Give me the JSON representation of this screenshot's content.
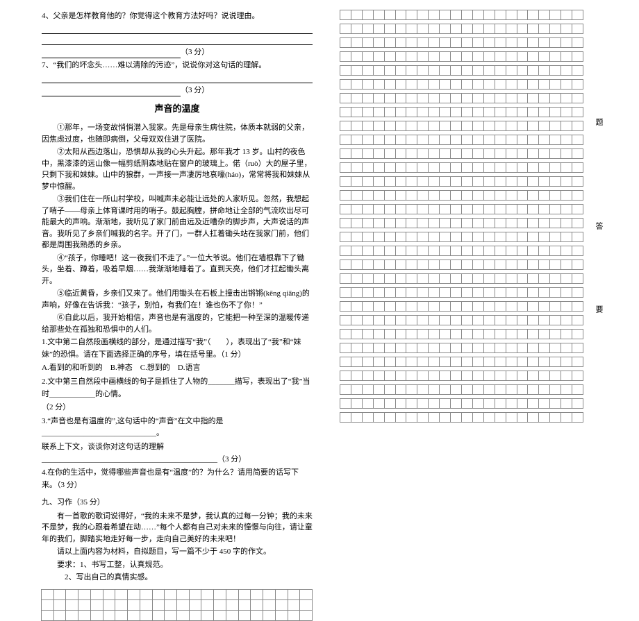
{
  "q4": {
    "prompt": "4、父亲是怎样教育他的？你觉得这个教育方法好吗？说说理由。",
    "score": "（3 分）"
  },
  "q7": {
    "prompt": "7、“我们的坏念头……难以清除的污迹”，说说你对这句话的理解。",
    "score": "（3 分）"
  },
  "reading": {
    "title": "声音的温度",
    "p1": "①那年，一场变故悄悄潜入我家。先是母亲生病住院，体质本就弱的父亲，因焦虑过度，也随即病倒，父母双双住进了医院。",
    "p2": "②太阳从西边落山，恐惧却从我的心头升起。那年我才 13 岁。山村的夜色中，黑漆漆的远山像一幅剪纸阴森地贴在窗户的玻璃上。偌（ruò）大的屋子里，只剩下我和妹妹。山中的狼群，一声接一声凄厉地哀嚎(háo)，常常将我和妹妹从梦中惊醒。",
    "p3": "③我们住在一所山村学校，叫喊声未必能让远处的人家听见。忽然，我想起了哨子——母亲上体育课时用的哨子。鼓起胸膛，拼命地让全部的气流吹出尽可能最大的声响。渐渐地，我听见了家门前由远及近嘈杂的脚步声，大声说话的声音。我听见了乡亲们喊我的名字。开了门，一群人扛着锄头站在我家门前，他们都是周围我熟悉的乡亲。",
    "p4": "④“孩子，你睡吧！这一夜我们不走了。”一位大爷说。他们在墙根靠下了锄头，坐着、蹲着，吸着早烟……我渐渐地睡着了。直到天亮，他们才扛起锄头离开。",
    "p5": "⑤临近黄昏，乡亲们又来了。他们用锄头在石板上撞击出锵锵(kēng qiāng)的声响，好像在告诉我：“孩子，别怕，有我们在！谁也伤不了你！”",
    "p6": "⑥自此以后，我开始相信，声音也是有温度的，它能把一种至深的温暖传递给那些处在孤独和恐惧中的人们。"
  },
  "questions": {
    "q1": "1.文中第二自然段画横线的部分，是通过描写“我”（　　），表现出了“我”和“妹妹”的恐惧。请在下面选择正确的序号，填在括号里。（1 分）",
    "q1opts": "A.看到的和听到的　B.神态　C.想到的　D.语言",
    "q2a": "2.文中第三自然段中画横线的句子是抓住了人物的_______描写，表现出了“我”当时____________的心情。",
    "q2b": "（2 分）",
    "q3a": "3.“声音也是有温度的”,这句话中的“声音”在文中指的是______________________________。",
    "q3b": "联系上下文，谈谈你对这句话的理解______________________________________________（3 分）",
    "q4": "4.在你的生活中，觉得哪些声音也是有“温度”的？为什么？请用简要的话写下来。（3 分）"
  },
  "essay": {
    "heading": "九、习作（35 分）",
    "p1": "有一首歌的歌词说得好，“我的未来不是梦，我认真的过每一分钟；我的未来不是梦，我的心跟着希望在动……”每个人都有自己对未来的憧憬与向往，请让童年的我们，脚踏实地走好每一步，走向自己美好的未来吧！",
    "p2": "请以上面内容为材料，自拟题目，写一篇不少于 450 字的作文。",
    "p3": "要求：1、书写工整，认真规范。",
    "p4": "　　　2、写出自己的真情实感。"
  },
  "labels": {
    "v1": "题",
    "v2": "答",
    "v3": "要"
  }
}
